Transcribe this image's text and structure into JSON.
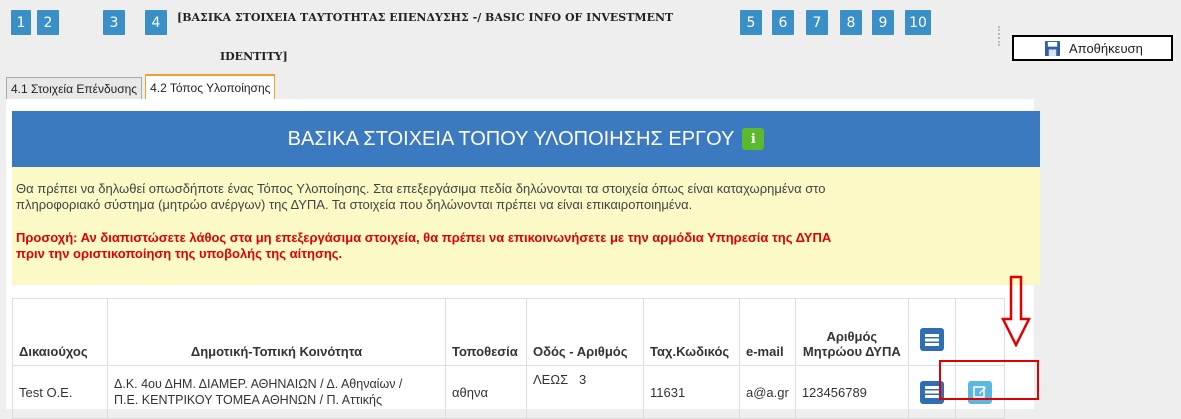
{
  "steps": [
    "1",
    "2",
    "3",
    "4",
    "5",
    "6",
    "7",
    "8",
    "9",
    "10"
  ],
  "step_title_line1": "[ΒΑΣΙΚΑ ΣΤΟΙΧΕΙΑ ΤΑΥΤΟΤΗΤΑΣ ΕΠΕΝΔΥΣΗΣ -/ BASIC INFO OF INVESTMENT",
  "step_title_line2": "IDENTITY]",
  "save_label": "Αποθήκευση",
  "tabs": [
    "4.1 Στοιχεία Επένδυσης",
    "4.2 Τόπος Υλοποίησης"
  ],
  "header_title": "ΒΑΣΙΚΑ ΣΤΟΙΧΕΙΑ ΤΟΠΟΥ ΥΛΟΠΟΙΗΣΗΣ ΕΡΓΟΥ",
  "info_line1": "Θα πρέπει να δηλωθεί οπωσδήποτε ένας Τόπος Υλοποίησης. Στα επεξεργάσιμα πεδία δηλώνονται τα στοιχεία όπως είναι καταχωρημένα στο",
  "info_line2": "πληροφοριακό σύστημα (μητρώο ανέργων) της ΔΥΠΑ. Τα στοιχεία που δηλώνονται πρέπει να είναι επικαιροποιημένα.",
  "warn_line1": "Προσοχή: Αν διαπιστώσετε λάθος στα μη επεξεργάσιμα στοιχεία, θα πρέπει να επικοινωνήσετε με την αρμόδια Υπηρεσία της ΔΥΠΑ",
  "warn_line2": "πριν την οριστικοποίηση της υποβολής της αίτησης.",
  "columns": {
    "beneficiary": "Δικαιούχος",
    "community": "Δημοτική-Τοπική Κοινότητα",
    "location": "Τοποθεσία",
    "street": "Οδός - Αριθμός",
    "postal": "Ταχ.Κωδικός",
    "email": "e-mail",
    "registry1": "Αριθμός",
    "registry2": "Μητρώου ΔΥΠΑ"
  },
  "row": {
    "beneficiary": "Test Ο.Ε.",
    "community1": "Δ.Κ. 4ου ΔΗΜ. ΔΙΑΜΕΡ. ΑΘΗΝΑΙΩΝ / Δ. Αθηναίων /",
    "community2": "Π.Ε. ΚΕΝΤΡΙΚΟΥ ΤΟΜΕΑ ΑΘΗΝΩΝ / Π. Αττικής",
    "location": "αθηνα",
    "street": "ΛΕΩΣ",
    "number": "3",
    "postal": "11631",
    "email": "a@a.gr",
    "registry": "123456789"
  },
  "colors": {
    "step": "#3a8fc7",
    "header": "#3b7ac0",
    "info_bg": "#fbf9c5",
    "warn": "#e00000",
    "badge": "#5cb82c"
  }
}
